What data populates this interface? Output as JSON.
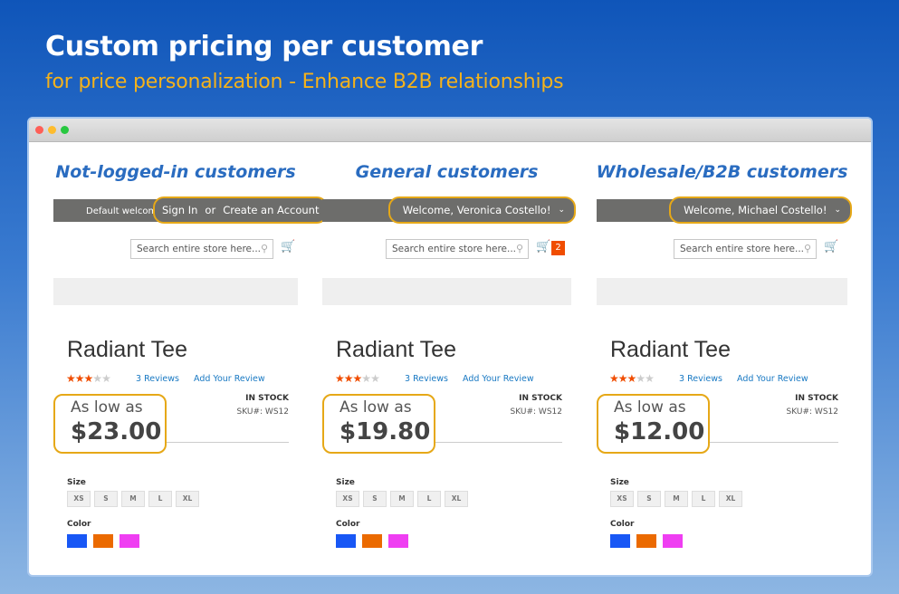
{
  "headline": "Custom pricing per customer",
  "subheadline": "for price personalization - Enhance B2B relationships",
  "colors": {
    "accent": "#e6a817",
    "title_blue": "#2a6cc0",
    "sale_badge": "#f04d00"
  },
  "panels": [
    {
      "heading": "Not-logged-in customers",
      "welcome": "Default welcome r",
      "sign_in": "Sign In",
      "or": "or",
      "create_account": "Create an Account",
      "search_placeholder": "Search entire store here...",
      "cart_count": "",
      "product": "Radiant Tee",
      "rating": 3,
      "reviews": "3  Reviews",
      "add_review": "Add Your Review",
      "stock": "IN STOCK",
      "sku": "SKU#:  WS12",
      "as_low_as": "As low as",
      "price": "$23.00",
      "size_label": "Size",
      "sizes": [
        "XS",
        "S",
        "M",
        "L",
        "XL"
      ],
      "color_label": "Color",
      "swatches": [
        "#1857f5",
        "#eb6a00",
        "#ef3ef2"
      ]
    },
    {
      "heading": "General customers",
      "welcome": "Welcome, Veronica Costello!",
      "search_placeholder": "Search entire store here...",
      "cart_count": "2",
      "product": "Radiant Tee",
      "rating": 3,
      "reviews": "3  Reviews",
      "add_review": "Add Your Review",
      "stock": "IN STOCK",
      "sku": "SKU#:  WS12",
      "as_low_as": "As low as",
      "price": "$19.80",
      "size_label": "Size",
      "sizes": [
        "XS",
        "S",
        "M",
        "L",
        "XL"
      ],
      "color_label": "Color",
      "swatches": [
        "#1857f5",
        "#eb6a00",
        "#ef3ef2"
      ]
    },
    {
      "heading": "Wholesale/B2B customers",
      "welcome": "Welcome, Michael Costello!",
      "search_placeholder": "Search entire store here...",
      "cart_count": "",
      "product": "Radiant Tee",
      "rating": 3,
      "reviews": "3  Reviews",
      "add_review": "Add Your Review",
      "stock": "IN STOCK",
      "sku": "SKU#:  WS12",
      "as_low_as": "As low as",
      "price": "$12.00",
      "size_label": "Size",
      "sizes": [
        "XS",
        "S",
        "M",
        "L",
        "XL"
      ],
      "color_label": "Color",
      "swatches": [
        "#1857f5",
        "#eb6a00",
        "#ef3ef2"
      ]
    }
  ]
}
